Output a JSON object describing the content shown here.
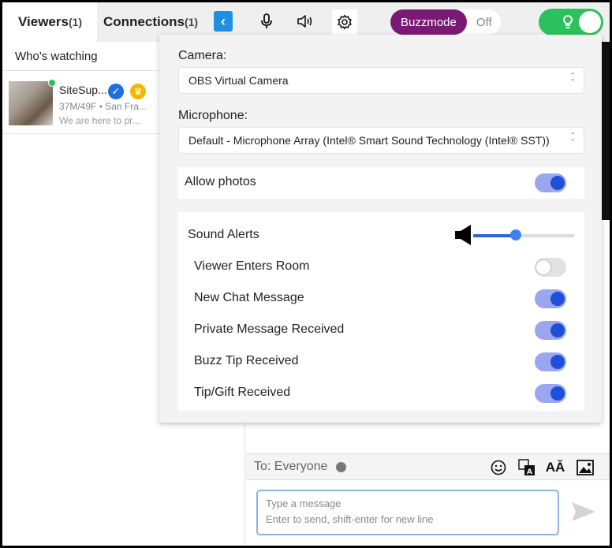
{
  "tabs": {
    "viewers_label": "Viewers",
    "viewers_count": "(1)",
    "connections_label": "Connections",
    "connections_count": "(1)"
  },
  "toolbar": {
    "back_icon": "chevron-left-icon",
    "mic_icon": "microphone-icon",
    "speaker_icon": "speaker-icon",
    "settings_icon": "gear-icon",
    "buzzmode_label": "Buzzmode",
    "buzzmode_state": "Off",
    "live_toggle_on": true,
    "accent": "#1e8fe1",
    "buzz_color": "#7a1a74",
    "live_color": "#2bc15d"
  },
  "viewers": {
    "header": "Who's watching",
    "items": [
      {
        "name": "SiteSup...",
        "meta": "37M/49F • San Fra...",
        "status": "We are here to pr...",
        "online": true,
        "verified": true,
        "crown": true
      }
    ]
  },
  "settings": {
    "camera_label": "Camera:",
    "camera_value": "OBS Virtual Camera",
    "microphone_label": "Microphone:",
    "microphone_value": "Default - Microphone Array (Intel® Smart Sound Technology (Intel® SST))",
    "allow_photos_label": "Allow photos",
    "allow_photos_on": true,
    "sound_alerts_label": "Sound Alerts",
    "sound_volume": 0.42,
    "alerts": [
      {
        "label": "Viewer Enters Room",
        "on": false
      },
      {
        "label": "New Chat Message",
        "on": true
      },
      {
        "label": "Private Message Received",
        "on": true
      },
      {
        "label": "Buzz Tip Received",
        "on": true
      },
      {
        "label": "Tip/Gift Received",
        "on": true
      }
    ]
  },
  "compose": {
    "to_label": "To: Everyone",
    "emoji_icon": "smiley-icon",
    "translate_icon": "translate-icon",
    "font_icon": "font-style-icon",
    "image_icon": "image-icon",
    "placeholder_line1": "Type a message",
    "placeholder_line2": "Enter to send, shift-enter for new line",
    "send_icon": "send-icon"
  }
}
